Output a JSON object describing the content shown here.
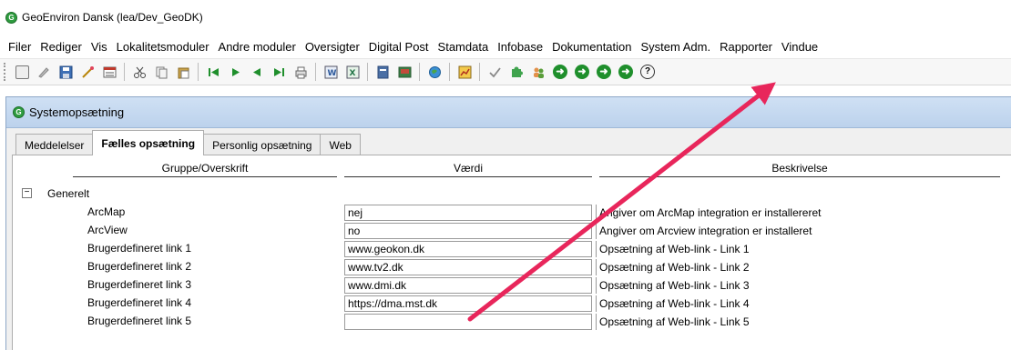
{
  "window": {
    "title": "GeoEnviron Dansk (lea/Dev_GeoDK)"
  },
  "menu": [
    "Filer",
    "Rediger",
    "Vis",
    "Lokalitetsmoduler",
    "Andre moduler",
    "Oversigter",
    "Digital Post",
    "Stamdata",
    "Infobase",
    "Dokumentation",
    "System Adm.",
    "Rapporter",
    "Vindue"
  ],
  "toolbar": {
    "go_glyph": "➜",
    "help_glyph": "?"
  },
  "dialog": {
    "title": "Systemopsætning",
    "tabs": [
      {
        "label": "Meddelelser"
      },
      {
        "label": "Fælles opsætning"
      },
      {
        "label": "Personlig opsætning"
      },
      {
        "label": "Web"
      }
    ],
    "active_tab": "Fælles opsætning"
  },
  "grid": {
    "columns": [
      "Gruppe/Overskrift",
      "Værdi",
      "Beskrivelse"
    ],
    "group": {
      "label": "Generelt",
      "toggle": "−"
    },
    "rows": [
      {
        "name": "ArcMap",
        "value": "nej",
        "description": "Angiver om ArcMap integration er installereret"
      },
      {
        "name": "ArcView",
        "value": "no",
        "description": "Angiver om Arcview integration er installeret"
      },
      {
        "name": "Brugerdefineret link 1",
        "value": "www.geokon.dk",
        "description": "Opsætning af Web-link - Link 1"
      },
      {
        "name": "Brugerdefineret link 2",
        "value": "www.tv2.dk",
        "description": "Opsætning af Web-link - Link 2"
      },
      {
        "name": "Brugerdefineret link 3",
        "value": "www.dmi.dk",
        "description": "Opsætning af Web-link - Link 3"
      },
      {
        "name": "Brugerdefineret link 4",
        "value": "https://dma.mst.dk",
        "description": "Opsætning af Web-link - Link 4"
      },
      {
        "name": "Brugerdefineret link 5",
        "value": "",
        "description": "Opsætning af Web-link - Link 5"
      }
    ]
  },
  "colors": {
    "accent_green": "#1f8f2c",
    "annotation_arrow": "#e8265b",
    "inner_title_bg": "#c4d8ef"
  }
}
